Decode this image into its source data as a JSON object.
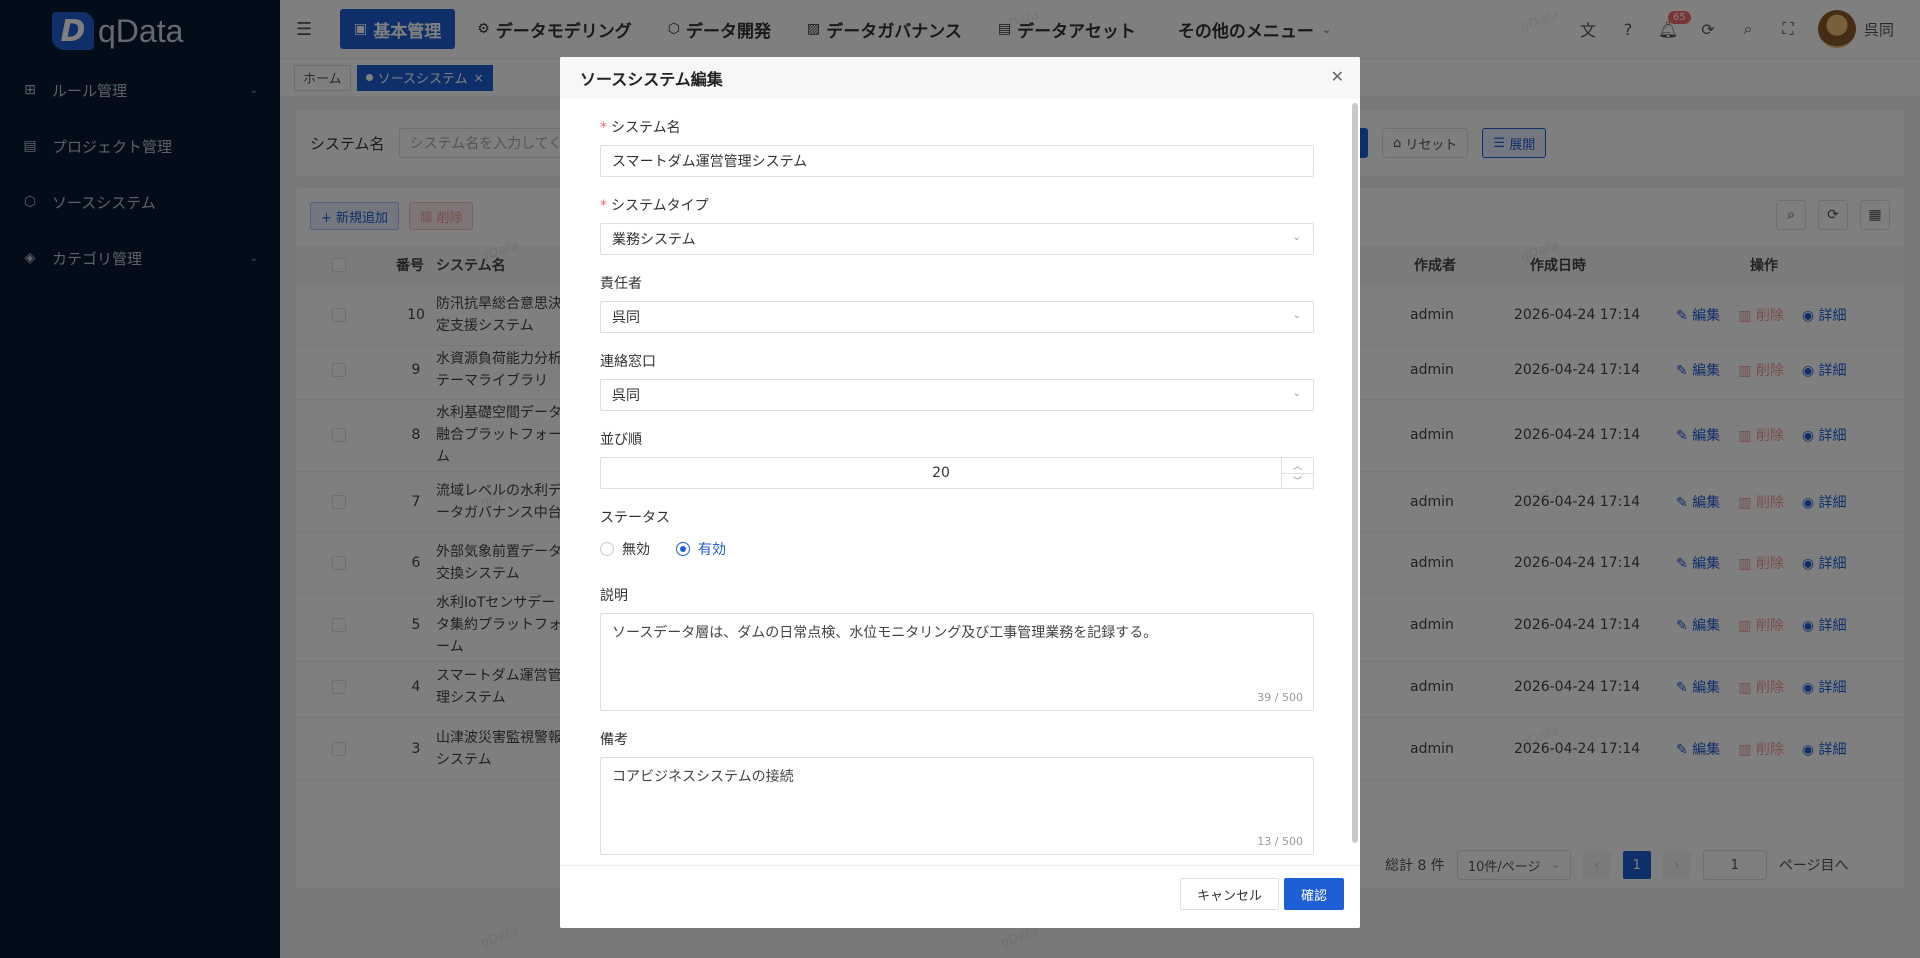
{
  "app": {
    "logo_mark": "D",
    "logo_text": "qData"
  },
  "sidebar": {
    "items": [
      {
        "label": "ルール管理",
        "icon": "grid-icon",
        "glyph": "⊞",
        "chevron": "⌄"
      },
      {
        "label": "プロジェクト管理",
        "icon": "document-icon",
        "glyph": "▤",
        "chevron": ""
      },
      {
        "label": "ソースシステム",
        "icon": "cube-icon",
        "glyph": "⬡",
        "chevron": ""
      },
      {
        "label": "カテゴリ管理",
        "icon": "layers-icon",
        "glyph": "◈",
        "chevron": "⌄"
      }
    ]
  },
  "header": {
    "nav": [
      {
        "label": "基本管理",
        "glyph": "▣"
      },
      {
        "label": "データモデリング",
        "glyph": "⚙"
      },
      {
        "label": "データ開発",
        "glyph": "⬡"
      },
      {
        "label": "データガバナンス",
        "glyph": "▨"
      },
      {
        "label": "データアセット",
        "glyph": "▤"
      },
      {
        "label": "その他のメニュー",
        "glyph": ""
      }
    ],
    "more_chevron": "⌄",
    "notification_count": "65",
    "username": "呉同"
  },
  "tabs": [
    {
      "label": "ホーム"
    },
    {
      "label": "ソースシステム",
      "close": "×"
    }
  ],
  "search": {
    "label": "システム名",
    "placeholder": "システム名を入力してく",
    "reset_label": "リセット",
    "expand_label": "展開"
  },
  "toolbar": {
    "add_label": "+ 新規追加",
    "delete_label": "削除"
  },
  "table": {
    "headers": {
      "no": "番号",
      "name": "システム名",
      "author": "作成者",
      "date": "作成日時",
      "ops": "操作"
    },
    "ops": {
      "edit": "編集",
      "delete": "削除",
      "detail": "詳細"
    },
    "rows": [
      {
        "no": "10",
        "name": "防汛抗旱総合意思決定支援システム",
        "author": "admin",
        "date": "2026-04-24 17:14"
      },
      {
        "no": "9",
        "name": "水資源負荷能力分析テーマライブラリ",
        "author": "admin",
        "date": "2026-04-24 17:14"
      },
      {
        "no": "8",
        "name": "水利基礎空間データ融合プラットフォーム",
        "author": "admin",
        "date": "2026-04-24 17:14"
      },
      {
        "no": "7",
        "name": "流域レベルの水利データガバナンス中台",
        "author": "admin",
        "date": "2026-04-24 17:14"
      },
      {
        "no": "6",
        "name": "外部気象前置データ交換システム",
        "author": "admin",
        "date": "2026-04-24 17:14"
      },
      {
        "no": "5",
        "name": "水利IoTセンサデータ集約プラットフォーム",
        "author": "admin",
        "date": "2026-04-24 17:14"
      },
      {
        "no": "4",
        "name": "スマートダム運営管理システム",
        "author": "admin",
        "date": "2026-04-24 17:14"
      },
      {
        "no": "3",
        "name": "山津波災害監視警報システム",
        "author": "admin",
        "date": "2026-04-24 17:14"
      }
    ]
  },
  "pager": {
    "total": "総計 8 件",
    "size": "10件/ページ",
    "current": "1",
    "jump": "1",
    "suffix": "ページ目へ"
  },
  "modal": {
    "title": "ソースシステム編集",
    "fields": {
      "system_name": {
        "label": "システム名",
        "value": "スマートダム運営管理システム"
      },
      "system_type": {
        "label": "システムタイプ",
        "value": "業務システム"
      },
      "owner": {
        "label": "責任者",
        "value": "呉同"
      },
      "contact": {
        "label": "連絡窓口",
        "value": "呉同"
      },
      "order": {
        "label": "並び順",
        "value": "20"
      },
      "status": {
        "label": "ステータス",
        "options": [
          "無効",
          "有効"
        ],
        "selected": "有効"
      },
      "description": {
        "label": "説明",
        "value": "ソースデータ層は、ダムの日常点検、水位モニタリング及び工事管理業務を記録する。",
        "count": "39 / 500"
      },
      "remarks": {
        "label": "備考",
        "value": "コアビジネスシステムの接続",
        "count": "13 / 500"
      }
    },
    "cancel_label": "キャンセル",
    "ok_label": "確認"
  },
  "watermark": "qData",
  "colors": {
    "primary": "#1f5fd6",
    "sidebar_bg": "#061a34",
    "danger": "#f56c6c"
  }
}
